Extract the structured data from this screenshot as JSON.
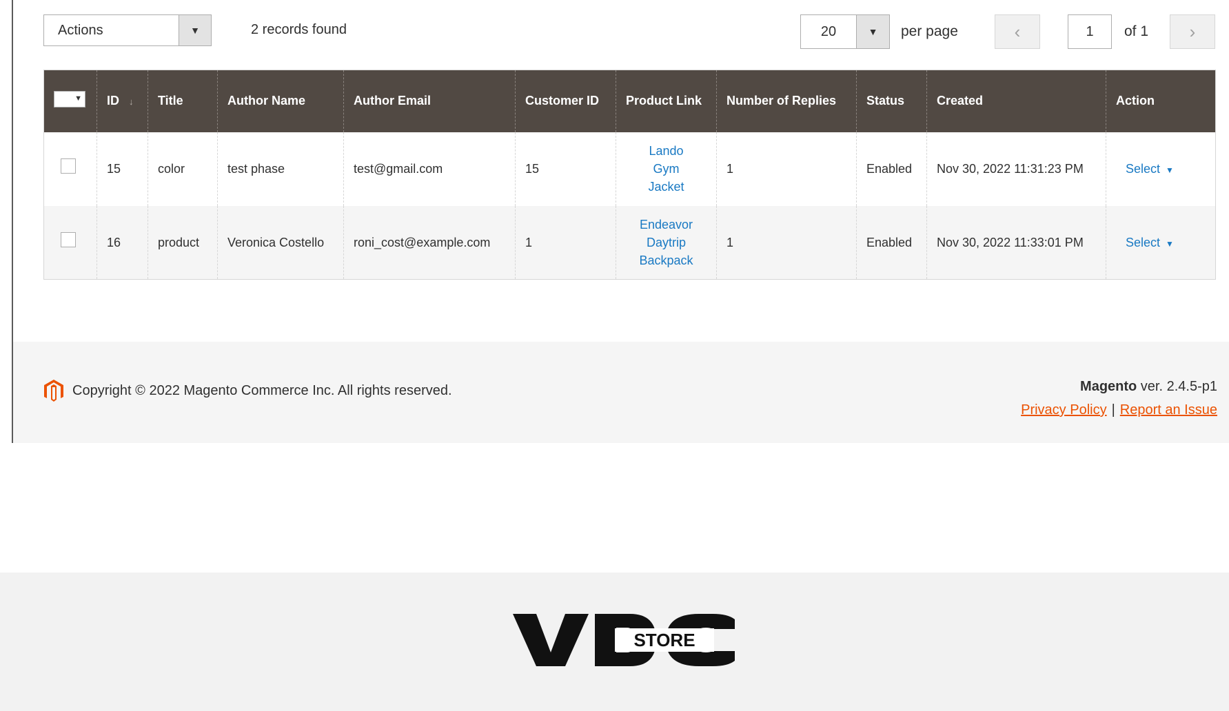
{
  "toolbar": {
    "actions_label": "Actions",
    "records_found": "2 records found",
    "per_page_value": "20",
    "per_page_label": "per page",
    "prev_icon": "chevron-left-icon",
    "next_icon": "chevron-right-icon",
    "page_value": "1",
    "page_of": "of 1"
  },
  "grid": {
    "columns": [
      "ID",
      "Title",
      "Author Name",
      "Author Email",
      "Customer ID",
      "Product Link",
      "Number of Replies",
      "Status",
      "Created",
      "Action"
    ],
    "rows": [
      {
        "id": "15",
        "title": "color",
        "author_name": "test phase",
        "author_email": "test@gmail.com",
        "customer_id": "15",
        "product_link": [
          "Lando",
          "Gym",
          "Jacket"
        ],
        "replies": "1",
        "status": "Enabled",
        "created": "Nov 30, 2022 11:31:23 PM",
        "action": "Select"
      },
      {
        "id": "16",
        "title": "product",
        "author_name": "Veronica Costello",
        "author_email": "roni_cost@example.com",
        "customer_id": "1",
        "product_link": [
          "Endeavor",
          "Daytrip",
          "Backpack"
        ],
        "replies": "1",
        "status": "Enabled",
        "created": "Nov 30, 2022 11:33:01 PM",
        "action": "Select"
      }
    ]
  },
  "footer": {
    "copyright": "Copyright © 2022 Magento Commerce Inc. All rights reserved.",
    "brand": "Magento",
    "version": " ver. 2.4.5-p1",
    "privacy": "Privacy Policy",
    "separator": "|",
    "report": "Report an Issue"
  },
  "banner": {
    "logo_text": "STORE"
  },
  "colors": {
    "header_bg": "#514943",
    "link": "#1979c3",
    "footer_link": "#eb5202",
    "magento_orange": "#eb5202"
  }
}
